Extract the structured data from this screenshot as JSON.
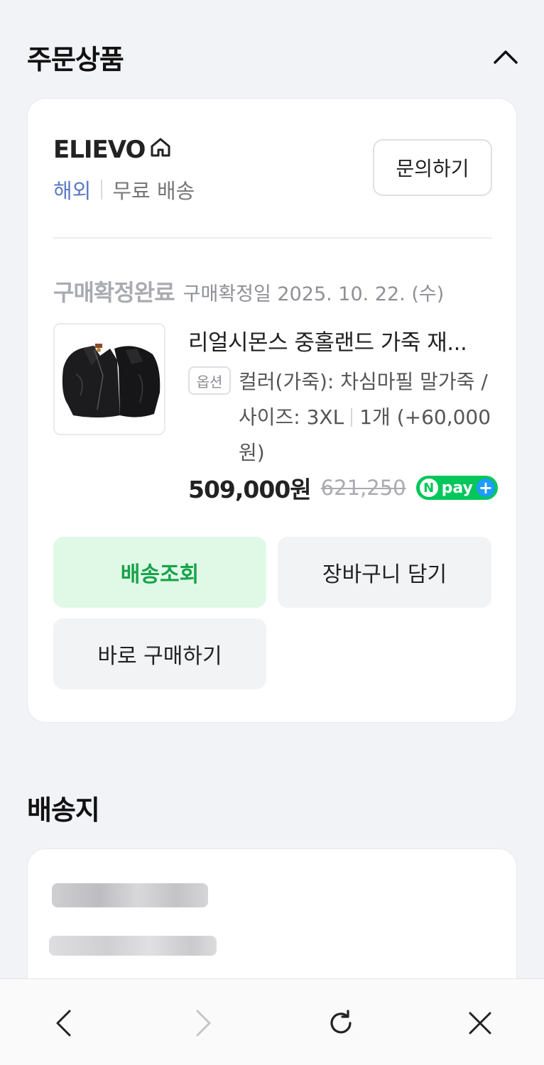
{
  "order_section": {
    "title": "주문상품"
  },
  "store": {
    "name": "ELIEVO",
    "region": "해외",
    "shipping": "무료 배송",
    "inquiry_label": "문의하기"
  },
  "order_status": {
    "status": "구매확정완료",
    "date_text": "구매확정일 2025. 10. 22. (수)"
  },
  "product": {
    "title": "리얼시몬스 중홀랜드 가죽 재...",
    "option_badge": "옵션",
    "option_main": "컬러(가죽): 차심마필 말가죽 / 사이즈: 3XL",
    "quantity_text": "1개 (+60,000원)",
    "price": "509,000원",
    "original_price": "621,250",
    "npay_n": "N",
    "npay_text": "pay",
    "npay_plus": "+"
  },
  "actions": {
    "tracking": "배송조회",
    "add_to_cart": "장바구니 담기",
    "buy_now": "바로 구매하기"
  },
  "shipping_section": {
    "title": "배송지"
  },
  "colors": {
    "accent_green": "#17a34a",
    "tracking_bg": "#e0f9e7",
    "overseas_blue": "#5a79c6",
    "npay_green": "#03c75a"
  },
  "icons": {
    "collapse": "chevron-up-icon",
    "store_home": "home-icon",
    "nav_back": "chevron-left-icon",
    "nav_forward": "chevron-right-icon",
    "nav_reload": "reload-icon",
    "nav_close": "close-icon"
  }
}
